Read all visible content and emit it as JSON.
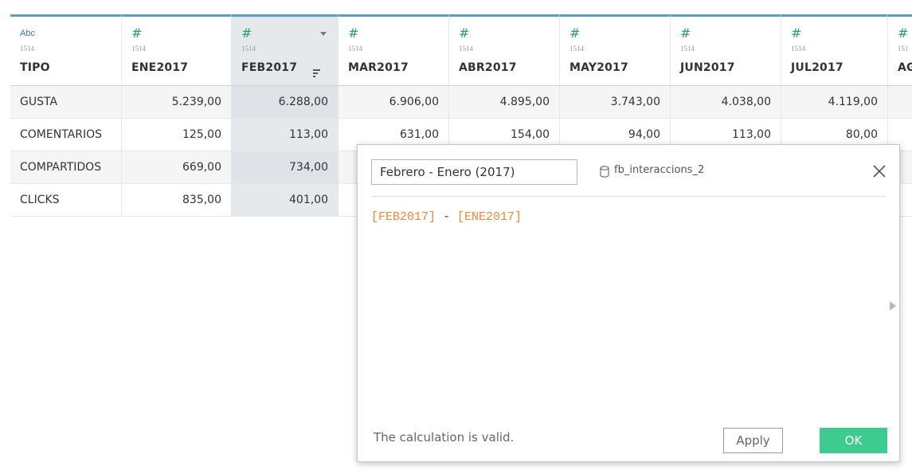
{
  "columns": [
    {
      "type_icon": "Abc",
      "source": "1514",
      "name": "TIPO"
    },
    {
      "type_icon": "#",
      "source": "1514",
      "name": "ENE2017"
    },
    {
      "type_icon": "#",
      "source": "1514",
      "name": "FEB2017"
    },
    {
      "type_icon": "#",
      "source": "1514",
      "name": "MAR2017"
    },
    {
      "type_icon": "#",
      "source": "1514",
      "name": "ABR2017"
    },
    {
      "type_icon": "#",
      "source": "1514",
      "name": "MAY2017"
    },
    {
      "type_icon": "#",
      "source": "1514",
      "name": "JUN2017"
    },
    {
      "type_icon": "#",
      "source": "1514",
      "name": "JUL2017"
    },
    {
      "type_icon": "#",
      "source": "151",
      "name": "AG"
    }
  ],
  "rows": [
    [
      "GUSTA",
      "5.239,00",
      "6.288,00",
      "6.906,00",
      "4.895,00",
      "3.743,00",
      "4.038,00",
      "4.119,00",
      ""
    ],
    [
      "COMENTARIOS",
      "125,00",
      "113,00",
      "631,00",
      "154,00",
      "94,00",
      "113,00",
      "80,00",
      ""
    ],
    [
      "COMPARTIDOS",
      "669,00",
      "734,00",
      "",
      "",
      "",
      "",
      "",
      ""
    ],
    [
      "CLICKS",
      "835,00",
      "401,00",
      "",
      "",
      "",
      "",
      "",
      ""
    ]
  ],
  "dialog": {
    "calc_name": "Febrero - Enero (2017)",
    "datasource": "fb_interaccions_2",
    "formula": {
      "ref1": "[FEB2017]",
      "operator": " - ",
      "ref2": "[ENE2017]"
    },
    "status": "The calculation is valid.",
    "apply_label": "Apply",
    "ok_label": "OK"
  },
  "colors": {
    "header_accent": "#5b9cc9",
    "number_type_icon": "#2e9e6b",
    "string_type_icon": "#3e74b5",
    "field_reference": "#e88a3c",
    "ok_button": "#3ecb90",
    "selected_column": "#e6e9ec"
  },
  "icons": {
    "number_type": "hash-icon",
    "string_type": "abc-icon",
    "datasource": "database-icon",
    "close": "close-icon",
    "sort": "sort-icon",
    "column_menu": "chevron-down-icon"
  }
}
